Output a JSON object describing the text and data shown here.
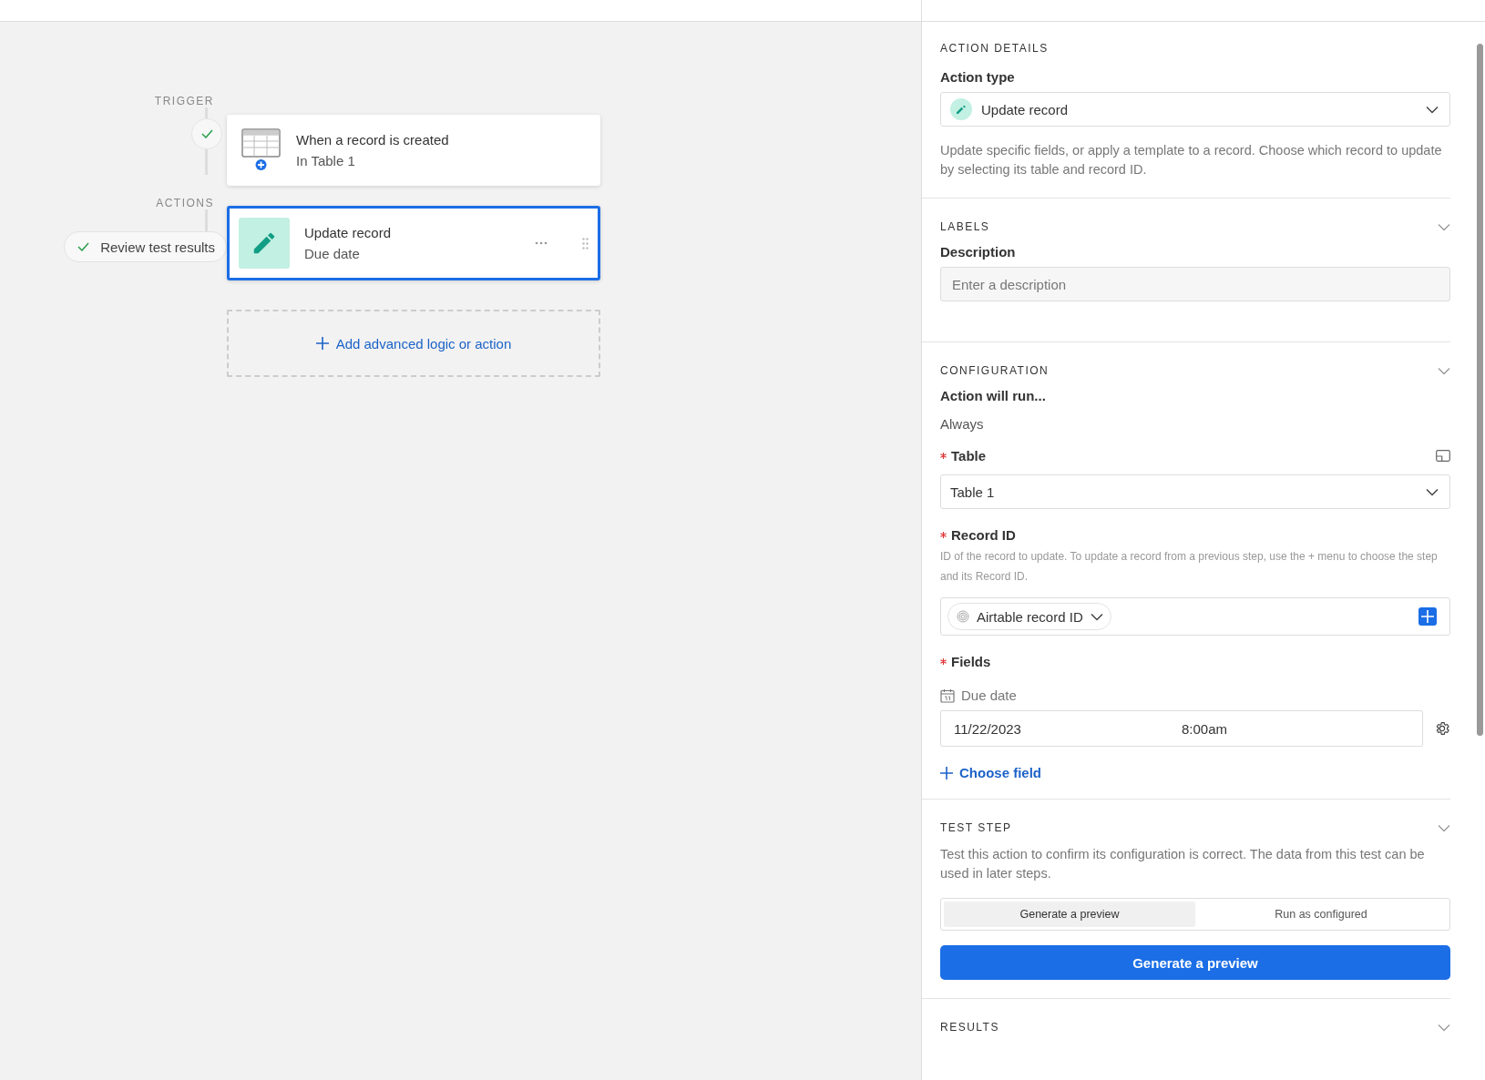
{
  "canvas": {
    "trigger_label": "TRIGGER",
    "trigger": {
      "title": "When a record is created",
      "subtitle": "In Table 1"
    },
    "actions_label": "ACTIONS",
    "review_button": "Review test results",
    "action": {
      "title": "Update record",
      "subtitle": "Due date",
      "selected": true
    },
    "add_button": "Add advanced logic or action"
  },
  "properties": {
    "action_details": {
      "heading": "ACTION DETAILS",
      "type_label": "Action type",
      "type_value": "Update record",
      "description": "Update specific fields, or apply a template to a record. Choose which record to update by selecting its table and record ID."
    },
    "labels": {
      "heading": "LABELS",
      "description_label": "Description",
      "description_placeholder": "Enter a description"
    },
    "configuration": {
      "heading": "CONFIGURATION",
      "run_label": "Action will run...",
      "run_value": "Always",
      "table_label": "Table",
      "table_required": true,
      "table_value": "Table 1",
      "record_label": "Record ID",
      "record_required": true,
      "record_help": "ID of the record to update. To update a record from a previous step, use the + menu to choose the step and its Record ID.",
      "record_token": "Airtable record ID",
      "fields_label": "Fields",
      "fields_required": true,
      "field": {
        "name": "Due date",
        "date": "11/22/2023",
        "time": "8:00am"
      },
      "choose_field": "Choose field"
    },
    "test_step": {
      "heading": "TEST STEP",
      "description": "Test this action to confirm its configuration is correct. The data from this test can be used in later steps.",
      "modes": [
        {
          "label": "Generate a preview",
          "selected": true
        },
        {
          "label": "Run as configured",
          "selected": false
        }
      ],
      "button": "Generate a preview"
    },
    "results": {
      "heading": "RESULTS"
    }
  }
}
